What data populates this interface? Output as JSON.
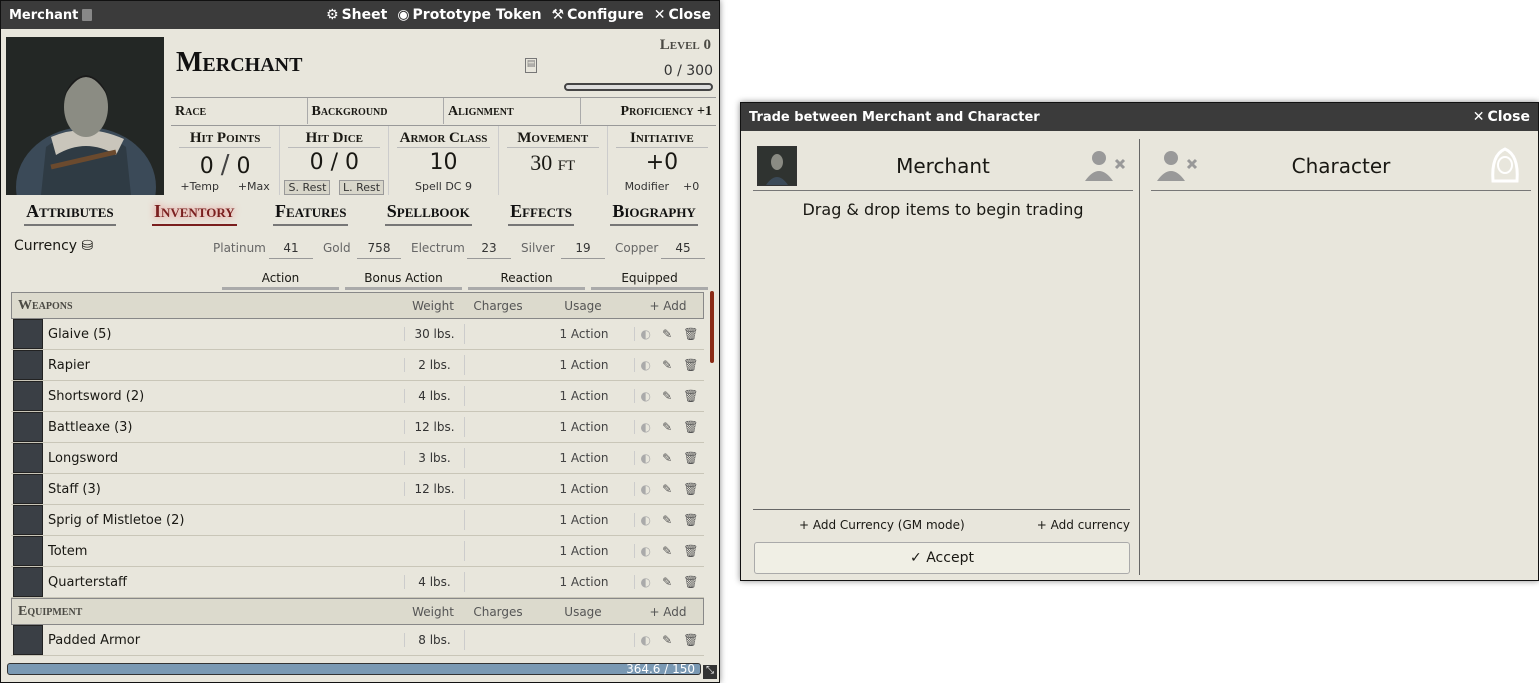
{
  "sheet": {
    "title": "Merchant",
    "header_buttons": {
      "sheet": "Sheet",
      "token": "Prototype Token",
      "configure": "Configure",
      "close": "Close"
    },
    "name": "Merchant",
    "level": "Level 0",
    "xp": "0 / 300",
    "summary": {
      "race": "Race",
      "background": "Background",
      "alignment": "Alignment",
      "proficiency": "Proficiency +1"
    },
    "attributes": {
      "hp": {
        "label": "Hit Points",
        "value": "0",
        "sep": "/",
        "max": "0",
        "temp": "+Temp",
        "tempmax": "+Max"
      },
      "hd": {
        "label": "Hit Dice",
        "value": "0 / 0",
        "short_rest": "S. Rest",
        "long_rest": "L. Rest"
      },
      "ac": {
        "label": "Armor Class",
        "value": "10",
        "sub": "Spell DC 9"
      },
      "movement": {
        "label": "Movement",
        "value": "30 ft"
      },
      "initiative": {
        "label": "Initiative",
        "value": "+0",
        "sub_label": "Modifier",
        "sub_value": "+0"
      }
    },
    "tabs": [
      "Attributes",
      "Inventory",
      "Features",
      "Spellbook",
      "Effects",
      "Biography"
    ],
    "currency": {
      "label": "Currency",
      "platinum_label": "Platinum",
      "platinum": "41",
      "gold_label": "Gold",
      "gold": "758",
      "electrum_label": "Electrum",
      "electrum": "23",
      "silver_label": "Silver",
      "silver": "19",
      "copper_label": "Copper",
      "copper": "45"
    },
    "filters": [
      "Action",
      "Bonus Action",
      "Reaction",
      "Equipped"
    ],
    "cols": {
      "weight": "Weight",
      "charges": "Charges",
      "usage": "Usage",
      "add": "+ Add"
    },
    "weapons_label": "Weapons",
    "weapons": [
      {
        "name": "Glaive (5)",
        "weight": "30 lbs.",
        "usage": "1 Action"
      },
      {
        "name": "Rapier",
        "weight": "2 lbs.",
        "usage": "1 Action"
      },
      {
        "name": "Shortsword (2)",
        "weight": "4 lbs.",
        "usage": "1 Action"
      },
      {
        "name": "Battleaxe (3)",
        "weight": "12 lbs.",
        "usage": "1 Action"
      },
      {
        "name": "Longsword",
        "weight": "3 lbs.",
        "usage": "1 Action"
      },
      {
        "name": "Staff (3)",
        "weight": "12 lbs.",
        "usage": "1 Action"
      },
      {
        "name": "Sprig of Mistletoe (2)",
        "weight": "",
        "usage": "1 Action"
      },
      {
        "name": "Totem",
        "weight": "",
        "usage": "1 Action"
      },
      {
        "name": "Quarterstaff",
        "weight": "4 lbs.",
        "usage": "1 Action"
      }
    ],
    "equipment_label": "Equipment",
    "equipment": [
      {
        "name": "Padded Armor",
        "weight": "8 lbs.",
        "usage": ""
      }
    ],
    "encumbrance": "364.6 / 150",
    "encumbrance_fraction": 1.0
  },
  "trade": {
    "title": "Trade between Merchant and Character",
    "close": "Close",
    "left_name": "Merchant",
    "right_name": "Character",
    "empty_msg": "Drag & drop items to begin trading",
    "add_currency_gm": "+ Add Currency (GM mode)",
    "add_currency": "+ Add currency",
    "accept": "✓ Accept"
  }
}
